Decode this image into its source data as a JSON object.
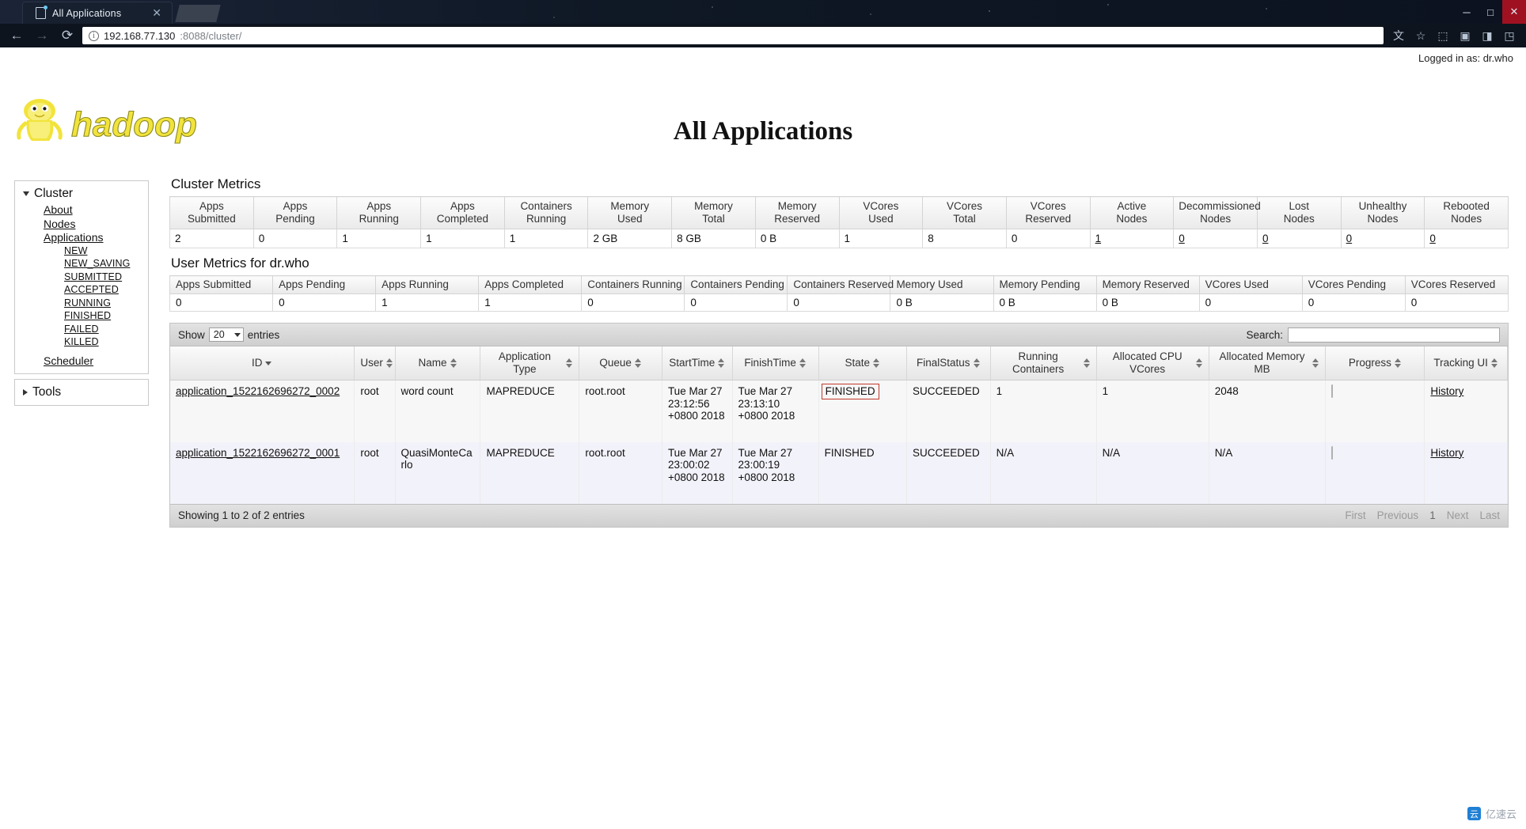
{
  "browser": {
    "tab_title": "All Applications",
    "close_tab_glyph": "✕",
    "back_glyph": "←",
    "forward_glyph": "→",
    "reload_glyph": "⟳",
    "info_glyph": "ⓘ",
    "url_host": "192.168.77.130",
    "url_rest": ":8088/cluster/",
    "url_full": "192.168.77.130:8088/cluster/",
    "translate_glyph": "文",
    "star_glyph": "☆",
    "ext_glyphs": [
      "⬚",
      "▣",
      "◨",
      "◳"
    ],
    "minimize_glyph": "─",
    "maximize_glyph": "□",
    "close_glyph": "✕",
    "restore_glyph": "❐"
  },
  "header": {
    "logged_in_as": "Logged in as: dr.who",
    "logo_text": "hadoop",
    "page_title": "All Applications"
  },
  "sidebar": {
    "cluster": {
      "label": "Cluster",
      "items": [
        {
          "label": "About"
        },
        {
          "label": "Nodes"
        },
        {
          "label": "Applications"
        }
      ],
      "app_states": [
        {
          "label": "NEW"
        },
        {
          "label": "NEW_SAVING"
        },
        {
          "label": "SUBMITTED"
        },
        {
          "label": "ACCEPTED"
        },
        {
          "label": "RUNNING"
        },
        {
          "label": "FINISHED"
        },
        {
          "label": "FAILED"
        },
        {
          "label": "KILLED"
        }
      ],
      "scheduler": {
        "label": "Scheduler"
      }
    },
    "tools": {
      "label": "Tools"
    }
  },
  "cluster_metrics": {
    "title": "Cluster Metrics",
    "headers": [
      {
        "line1": "Apps",
        "line2": "Submitted"
      },
      {
        "line1": "Apps",
        "line2": "Pending"
      },
      {
        "line1": "Apps",
        "line2": "Running"
      },
      {
        "line1": "Apps",
        "line2": "Completed"
      },
      {
        "line1": "Containers",
        "line2": "Running"
      },
      {
        "line1": "Memory",
        "line2": "Used"
      },
      {
        "line1": "Memory",
        "line2": "Total"
      },
      {
        "line1": "Memory",
        "line2": "Reserved"
      },
      {
        "line1": "VCores",
        "line2": "Used"
      },
      {
        "line1": "VCores",
        "line2": "Total"
      },
      {
        "line1": "VCores",
        "line2": "Reserved"
      },
      {
        "line1": "Active",
        "line2": "Nodes"
      },
      {
        "line1": "Decommissioned",
        "line2": "Nodes"
      },
      {
        "line1": "Lost",
        "line2": "Nodes"
      },
      {
        "line1": "Unhealthy",
        "line2": "Nodes"
      },
      {
        "line1": "Rebooted",
        "line2": "Nodes"
      }
    ],
    "values": [
      "2",
      "0",
      "1",
      "1",
      "1",
      "2 GB",
      "8 GB",
      "0 B",
      "1",
      "8",
      "0",
      "1",
      "0",
      "0",
      "0",
      "0"
    ],
    "linked_value_indices": [
      11,
      12,
      13,
      14,
      15
    ]
  },
  "user_metrics": {
    "title": "User Metrics for dr.who",
    "headers": [
      "Apps Submitted",
      "Apps Pending",
      "Apps Running",
      "Apps Completed",
      "Containers Running",
      "Containers Pending",
      "Containers Reserved",
      "Memory Used",
      "Memory Pending",
      "Memory Reserved",
      "VCores Used",
      "VCores Pending",
      "VCores Reserved"
    ],
    "values": [
      "0",
      "0",
      "1",
      "1",
      "0",
      "0",
      "0",
      "0 B",
      "0 B",
      "0 B",
      "0",
      "0",
      "0"
    ]
  },
  "datatable": {
    "show_label": "Show",
    "page_length": "20",
    "entries_label": "entries",
    "search_label": "Search:",
    "search_value": "",
    "search_placeholder": "",
    "info": "Showing 1 to 2 of 2 entries",
    "paging": {
      "first": "First",
      "previous": "Previous",
      "current_page": "1",
      "next": "Next",
      "last": "Last"
    },
    "columns": [
      {
        "label": "ID",
        "sort": "desc"
      },
      {
        "label": "User",
        "sort": "both"
      },
      {
        "label": "Name",
        "sort": "both"
      },
      {
        "label": "Application Type",
        "sort": "both"
      },
      {
        "label": "Queue",
        "sort": "both"
      },
      {
        "label": "StartTime",
        "sort": "both"
      },
      {
        "label": "FinishTime",
        "sort": "both"
      },
      {
        "label": "State",
        "sort": "both"
      },
      {
        "label": "FinalStatus",
        "sort": "both"
      },
      {
        "label": "Running Containers",
        "sort": "both"
      },
      {
        "label": "Allocated CPU VCores",
        "sort": "both"
      },
      {
        "label": "Allocated Memory MB",
        "sort": "both"
      },
      {
        "label": "Progress",
        "sort": "both"
      },
      {
        "label": "Tracking UI",
        "sort": "both"
      }
    ],
    "rows": [
      {
        "id": "application_1522162696272_0002",
        "user": "root",
        "name": "word count",
        "application_type": "MAPREDUCE",
        "queue": "root.root",
        "start_time": "Tue Mar 27 23:12:56 +0800 2018",
        "finish_time": "Tue Mar 27 23:13:10 +0800 2018",
        "state": "FINISHED",
        "final_status": "SUCCEEDED",
        "running_containers": "1",
        "allocated_cpu_vcores": "1",
        "allocated_memory_mb": "2048",
        "progress": "",
        "tracking_ui": "History",
        "state_highlighted": true
      },
      {
        "id": "application_1522162696272_0001",
        "user": "root",
        "name": "QuasiMonteCarlo",
        "application_type": "MAPREDUCE",
        "queue": "root.root",
        "start_time": "Tue Mar 27 23:00:02 +0800 2018",
        "finish_time": "Tue Mar 27 23:00:19 +0800 2018",
        "state": "FINISHED",
        "final_status": "SUCCEEDED",
        "running_containers": "N/A",
        "allocated_cpu_vcores": "N/A",
        "allocated_memory_mb": "N/A",
        "progress": "",
        "tracking_ui": "History",
        "state_highlighted": false
      }
    ]
  },
  "watermark": {
    "text": "亿速云",
    "icon": "云"
  },
  "colors": {
    "highlight_border": "#c0392b",
    "hadoop_yellow": "#f5e642",
    "link": "#111111"
  }
}
